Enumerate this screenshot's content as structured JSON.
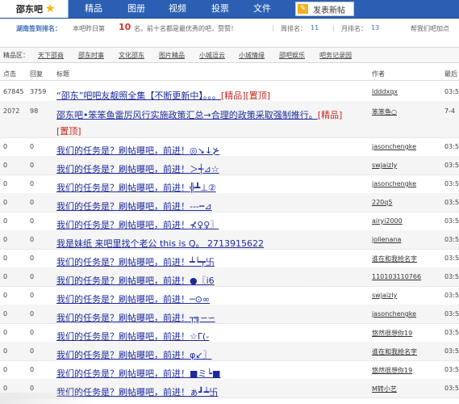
{
  "forum_name": "邵东吧",
  "nav": [
    "精品",
    "图册",
    "视频",
    "投票",
    "文件"
  ],
  "post_button": "发表新帖",
  "rank": {
    "title": "湖南签到排名：",
    "text_a": "本吧昨日第",
    "rank_no": "10",
    "text_b": "名。前十名都是最优秀的吧，赞赞！",
    "zhou_label": "周排名：",
    "zhou_val": "11",
    "yue_label": "月排名：",
    "yue_val": "13",
    "right": "帮我们吧加点"
  },
  "categories": {
    "label": "精品区：",
    "items": [
      "天下邵商",
      "邵东时事",
      "文化邵东",
      "图片精品",
      "小城逗云",
      "小城情缘",
      "邵吧娱乐",
      "吧务记录园"
    ]
  },
  "columns": [
    "点击",
    "回复",
    "标题",
    "作者",
    "最后"
  ],
  "threads": [
    {
      "clicks": "67845",
      "replies": "3759",
      "title": "“邵东”吧吧友靓照全集【不断更新中】。。。",
      "tags": [
        "[精品]",
        "[置顶]"
      ],
      "author": "ldddxqx",
      "time": "03:5"
    },
    {
      "clicks": "2072",
      "replies": "98",
      "title": "邵东吧•笨笨鱼雷厉风行实施政策汇总→合理的政策采取强制推行。",
      "tags": [
        "[精品]"
      ],
      "tags2": [
        "[置顶]"
      ],
      "author": "笨笨鱼○",
      "time": "7-4"
    },
    {
      "clicks": "0",
      "replies": "0",
      "title": "我们的任务是？刷帖曝吧，前进！◎↘↓⊁",
      "tags": [],
      "author": "jasonchengke",
      "time": "03:5"
    },
    {
      "clicks": "0",
      "replies": "0",
      "title": "我们的任务是？刷帖曝吧，前进！＞┽⊿☆",
      "tags": [],
      "author": "swjaizly",
      "time": "03:5"
    },
    {
      "clicks": "0",
      "replies": "0",
      "title": "我们的任务是？刷帖曝吧，前进！╬┻⊥②",
      "tags": [],
      "author": "jasonchengke",
      "time": "03:5"
    },
    {
      "clicks": "0",
      "replies": "0",
      "title": "我们的任务是？刷帖曝吧，前进！---┅⊿",
      "tags": [],
      "author": "220q5",
      "time": "03:5"
    },
    {
      "clicks": "0",
      "replies": "0",
      "title": "我们的任务是？刷帖曝吧，前进！⊀♀♀〗",
      "tags": [],
      "author": "airyi2000",
      "time": "03:5"
    },
    {
      "clicks": "0",
      "replies": "0",
      "title": "我是妹纸 来吧里找个老公 this is Q。 2713915622",
      "tags": [],
      "author": "jolienana",
      "time": "03:5"
    },
    {
      "clicks": "0",
      "replies": "0",
      "title": "我们的任务是？刷帖曝吧，前进！┷┕┯卐",
      "tags": [],
      "author": "谁在和我抢名字",
      "time": "03:5"
    },
    {
      "clicks": "0",
      "replies": "0",
      "title": "我们的任务是？刷帖曝吧，前进！●〖ⅰ6",
      "tags": [],
      "author": "110103110766",
      "time": "03:5"
    },
    {
      "clicks": "0",
      "replies": "0",
      "title": "我们的任务是？刷帖曝吧，前进！─⊙∞",
      "tags": [],
      "author": "swjaizly",
      "time": "03:5"
    },
    {
      "clicks": "0",
      "replies": "0",
      "title": "我们的任务是？刷帖曝吧，前进！┬╗∽∽",
      "tags": [],
      "author": "jasonchengke",
      "time": "03:5"
    },
    {
      "clicks": "0",
      "replies": "0",
      "title": "我们的任务是？刷帖曝吧，前进！☆Γ(-",
      "tags": [],
      "author": "悠然很想你19",
      "time": "03:5"
    },
    {
      "clicks": "0",
      "replies": "0",
      "title": "我们的任务是？刷帖曝吧，前进！φ↙〗",
      "tags": [],
      "author": "谁在和我抢名字",
      "time": "03:5"
    },
    {
      "clicks": "0",
      "replies": "0",
      "title": "我们的任务是？刷帖曝吧，前进！■ミ┕■",
      "tags": [],
      "author": "悠然很想你19",
      "time": "03:5"
    },
    {
      "clicks": "0",
      "replies": "0",
      "title": "我们的任务是？刷帖曝吧，前进！ぁ┛┷卐",
      "tags": [],
      "author": "M转小艺",
      "time": "03:5"
    }
  ],
  "colors": {
    "topbar": "#2a5fb3",
    "link": "#1e2a9c",
    "tag": "#c8281e",
    "accent": "#d3342c"
  }
}
